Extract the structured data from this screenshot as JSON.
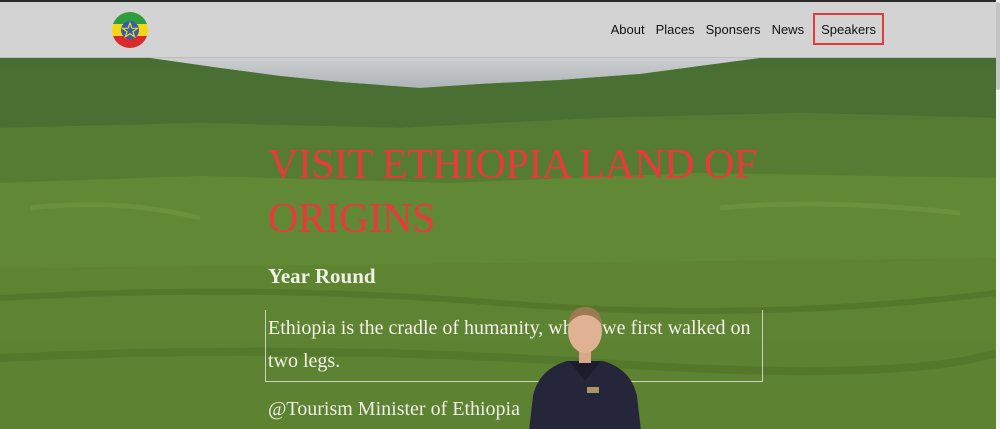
{
  "navbar": {
    "logo_icon": "ethiopia-flag-emblem-icon",
    "links": [
      {
        "label": "About"
      },
      {
        "label": "Places"
      },
      {
        "label": "Sponsers"
      },
      {
        "label": "News"
      },
      {
        "label": "Speakers",
        "active": true
      }
    ]
  },
  "hero": {
    "headline": "VISIT ETHIOPIA LAND OF ORIGINS",
    "subheading": "Year Round",
    "quote": "Ethiopia is the cradle of humanity, where we first walked on two legs.",
    "attribution": "@Tourism Minister of Ethiopia",
    "background": "green-highlands-landscape",
    "speaker_photo": "man-in-dark-jacket"
  },
  "colors": {
    "navbar_bg": "#d3d3d3",
    "headline": "#e83a3a",
    "active_border": "#e23b3b"
  }
}
